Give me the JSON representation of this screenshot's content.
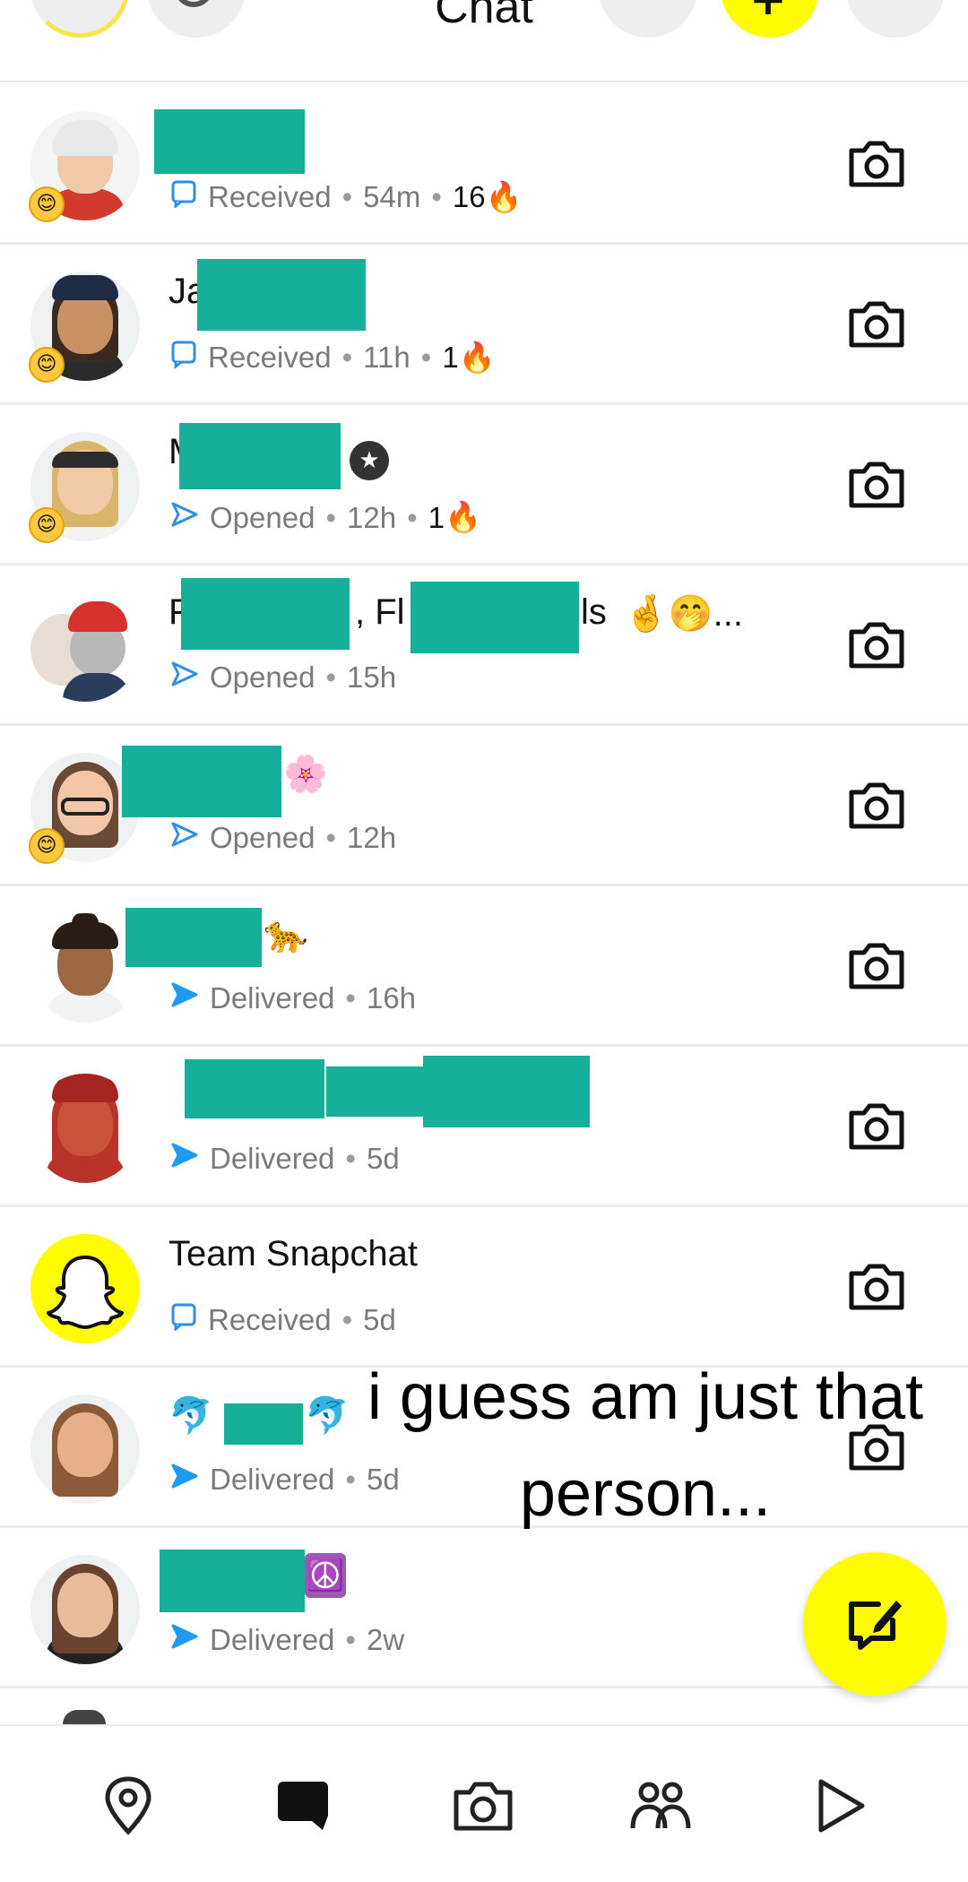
{
  "header": {
    "title": "Chat",
    "add_glyph": "+"
  },
  "chats": [
    {
      "name": "",
      "name_suffix": "",
      "status": "Received",
      "status_icon": "chat-outline-icon",
      "time": "54m",
      "streak": "16",
      "streak_emoji": "🔥",
      "mood": "😊"
    },
    {
      "name": "Ja",
      "name_suffix": "",
      "status": "Received",
      "status_icon": "chat-outline-icon",
      "time": "11h",
      "streak": "1",
      "streak_emoji": "🔥",
      "mood": "😊"
    },
    {
      "name": "M",
      "name_suffix": "",
      "status": "Opened",
      "status_icon": "arrow-outline-icon",
      "time": "12h",
      "streak": "1",
      "streak_emoji": "🔥",
      "mood": "😊"
    },
    {
      "name": "F",
      "name_mid": ", Fl",
      "name_tail": "ls",
      "name_suffix": "🤞🤭...",
      "status": "Opened",
      "status_icon": "arrow-outline-icon",
      "time": "15h",
      "streak": "",
      "streak_emoji": "",
      "mood": ""
    },
    {
      "name": "",
      "name_suffix": "🌸",
      "status": "Opened",
      "status_icon": "arrow-outline-icon",
      "time": "12h",
      "streak": "",
      "streak_emoji": "",
      "mood": "😊"
    },
    {
      "name": "",
      "name_suffix": "🐆",
      "status": "Delivered",
      "status_icon": "arrow-filled-icon",
      "time": "16h",
      "streak": "",
      "streak_emoji": "",
      "mood": ""
    },
    {
      "name": "",
      "name_suffix": "",
      "status": "Delivered",
      "status_icon": "arrow-filled-icon",
      "time": "5d",
      "streak": "",
      "streak_emoji": "",
      "mood": ""
    },
    {
      "name": "Team Snapchat",
      "name_suffix": "",
      "status": "Received",
      "status_icon": "chat-outline-icon",
      "time": "5d",
      "streak": "",
      "streak_emoji": "",
      "mood": ""
    },
    {
      "name": "🐬",
      "name_suffix": "🐬",
      "status": "Delivered",
      "status_icon": "arrow-filled-icon",
      "time": "5d",
      "streak": "",
      "streak_emoji": "",
      "mood": ""
    },
    {
      "name": "",
      "name_suffix": "☮️",
      "status": "Delivered",
      "status_icon": "arrow-filled-icon",
      "time": "2w",
      "streak": "",
      "streak_emoji": "",
      "mood": ""
    }
  ],
  "caption": {
    "line1": "i guess am just that",
    "line2": "person..."
  },
  "colors": {
    "brand_yellow": "#fffc00",
    "redaction": "#16b09a",
    "sent_blue": "#1e9bf0",
    "received_blue": "#2f8fe6"
  },
  "nav": [
    "map-icon",
    "chat-icon",
    "camera-icon",
    "friends-icon",
    "stories-icon"
  ]
}
